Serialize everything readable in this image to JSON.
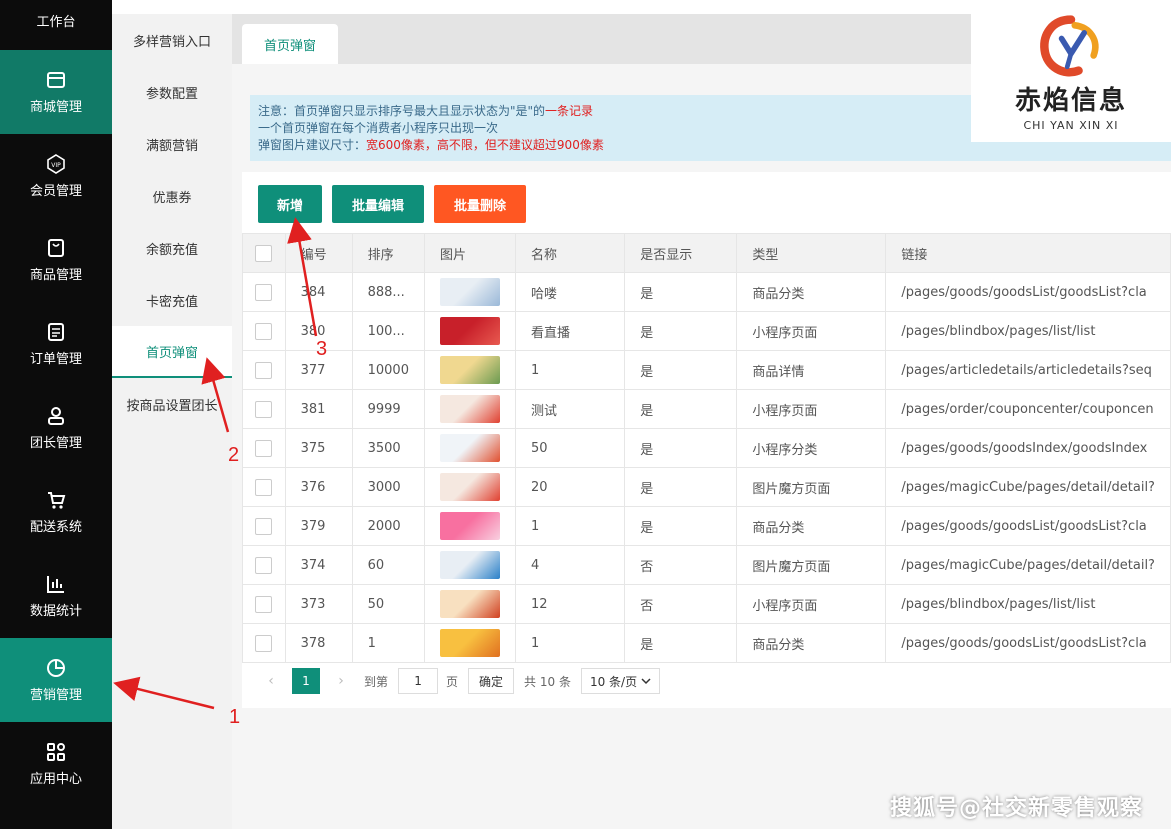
{
  "nav": {
    "items": [
      {
        "label": "工作台",
        "icon": "dashboard-icon"
      },
      {
        "label": "商城管理",
        "icon": "store-icon"
      },
      {
        "label": "会员管理",
        "icon": "vip-icon"
      },
      {
        "label": "商品管理",
        "icon": "bag-icon"
      },
      {
        "label": "订单管理",
        "icon": "order-icon"
      },
      {
        "label": "团长管理",
        "icon": "user-icon"
      },
      {
        "label": "配送系统",
        "icon": "cart-icon"
      },
      {
        "label": "数据统计",
        "icon": "chart-icon"
      },
      {
        "label": "营销管理",
        "icon": "pie-icon"
      },
      {
        "label": "应用中心",
        "icon": "apps-icon"
      }
    ]
  },
  "submenu": {
    "items": [
      {
        "label": "多样营销入口"
      },
      {
        "label": "参数配置"
      },
      {
        "label": "满额营销"
      },
      {
        "label": "优惠券"
      },
      {
        "label": "余额充值"
      },
      {
        "label": "卡密充值"
      },
      {
        "label": "首页弹窗"
      },
      {
        "label": "按商品设置团长"
      }
    ]
  },
  "tab": {
    "label": "首页弹窗"
  },
  "notice": {
    "line1_a": "注意：首页弹窗只显示排序号最大且显示状态为\"是\"的",
    "line1_b": "一条记录",
    "line2": "一个首页弹窗在每个消费者小程序只出现一次",
    "line3_a": "弹窗图片建议尺寸：",
    "line3_b": "宽600像素，高不限，但不建议超过900像素"
  },
  "toolbar": {
    "add": "新增",
    "batch_edit": "批量编辑",
    "batch_delete": "批量删除"
  },
  "table": {
    "headers": [
      "编号",
      "排序",
      "图片",
      "名称",
      "是否显示",
      "类型",
      "链接"
    ],
    "rows": [
      {
        "id": "384",
        "sort": "888...",
        "name": "哈喽",
        "show": "是",
        "type": "商品分类",
        "link": "/pages/goods/goodsList/goodsList?cla"
      },
      {
        "id": "380",
        "sort": "100...",
        "name": "看直播",
        "show": "是",
        "type": "小程序页面",
        "link": "/pages/blindbox/pages/list/list"
      },
      {
        "id": "377",
        "sort": "10000",
        "name": "1",
        "show": "是",
        "type": "商品详情",
        "link": "/pages/articledetails/articledetails?seq"
      },
      {
        "id": "381",
        "sort": "9999",
        "name": "测试",
        "show": "是",
        "type": "小程序页面",
        "link": "/pages/order/couponcenter/couponcen"
      },
      {
        "id": "375",
        "sort": "3500",
        "name": "50",
        "show": "是",
        "type": "小程序分类",
        "link": "/pages/goods/goodsIndex/goodsIndex"
      },
      {
        "id": "376",
        "sort": "3000",
        "name": "20",
        "show": "是",
        "type": "图片魔方页面",
        "link": "/pages/magicCube/pages/detail/detail?"
      },
      {
        "id": "379",
        "sort": "2000",
        "name": "1",
        "show": "是",
        "type": "商品分类",
        "link": "/pages/goods/goodsList/goodsList?cla"
      },
      {
        "id": "374",
        "sort": "60",
        "name": "4",
        "show": "否",
        "type": "图片魔方页面",
        "link": "/pages/magicCube/pages/detail/detail?"
      },
      {
        "id": "373",
        "sort": "50",
        "name": "12",
        "show": "否",
        "type": "小程序页面",
        "link": "/pages/blindbox/pages/list/list"
      },
      {
        "id": "378",
        "sort": "1",
        "name": "1",
        "show": "是",
        "type": "商品分类",
        "link": "/pages/goods/goodsList/goodsList?cla"
      }
    ]
  },
  "pager": {
    "current": "1",
    "goto_label": "到第",
    "goto_value": "1",
    "page_label": "页",
    "confirm": "确定",
    "total": "共 10 条",
    "per_page": "10 条/页"
  },
  "logo": {
    "text": "赤焰信息",
    "sub": "CHI YAN XIN XI"
  },
  "watermark": "搜狐号@社交新零售观察",
  "annotations": {
    "a1": "1",
    "a2": "2",
    "a3": "3"
  },
  "colors": {
    "accent": "#0f8f7a",
    "danger": "#ff5722",
    "notice_bg": "#d6edf6",
    "annotation": "#e02020"
  }
}
